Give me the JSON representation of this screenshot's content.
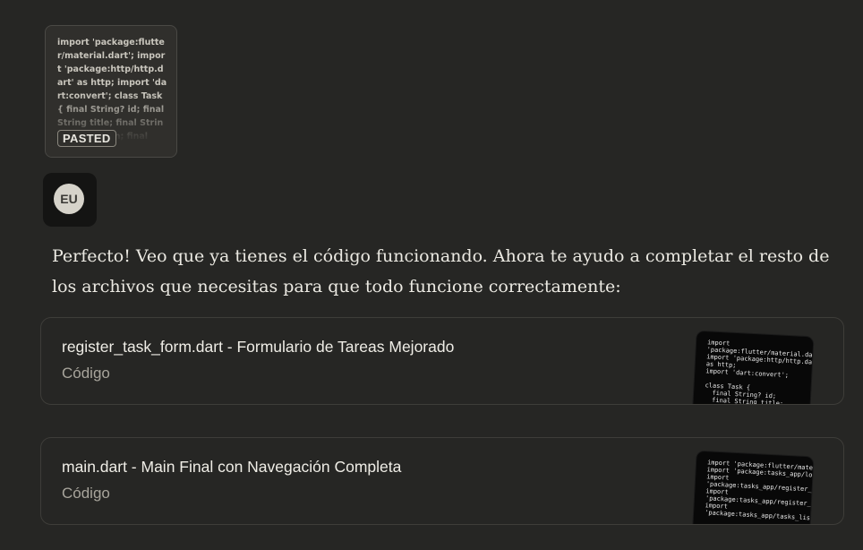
{
  "pasted": {
    "preview_text": "import 'package:flutter/material.dart'; import 'package:http/http.dart' as http; import 'dart:convert'; class Task { final String? id; final String title; final String description; final",
    "badge": "PASTED"
  },
  "avatar": {
    "initials": "EU"
  },
  "message": {
    "text": "Perfecto! Veo que ya tienes el código funcionando. Ahora te ayudo a completar el resto de los archivos que necesitas para que todo funcione correctamente:"
  },
  "artifacts": [
    {
      "title": "register_task_form.dart - Formulario de Tareas Mejorado",
      "type": "Código",
      "thumb_code": "import\n'package:flutter/material.dart';\nimport 'package:http/http.dart'\nas http;\nimport 'dart:convert';\n\nclass Task {\n  final String? id;\n  final String title;\n  final String description;"
    },
    {
      "title": "main.dart - Main Final con Navegación Completa",
      "type": "Código",
      "thumb_code": "import 'package:flutter/material.dart';\nimport 'package:tasks_app/login_screen.dart';\nimport\n'package:tasks_app/register_form.dart';\nimport\n'package:tasks_app/register_task_form.dart';\nimport\n'package:tasks_app/tasks_list_screen.dart';\n\nvoid main() {"
    }
  ]
}
